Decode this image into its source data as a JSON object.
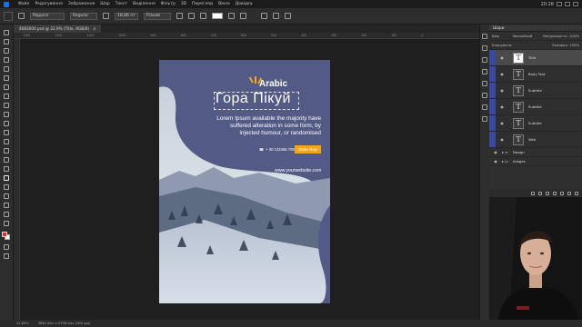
{
  "menu": [
    "Файл",
    "Редагування",
    "Зображення",
    "Шар",
    "Текст",
    "Виділення",
    "Фільтр",
    "3D",
    "Перегляд",
    "Вікно",
    "Довідка"
  ],
  "options": {
    "font_family": "Poppins",
    "font_style": "Regular",
    "font_size": "18,86 пт",
    "aa": "Різкий"
  },
  "document": {
    "tab_label": "4683000.psd @ 22,9% (Title, RGB/8)",
    "close": "×"
  },
  "ruler_ticks": [
    "1300",
    "1200",
    "1100",
    "1000",
    "900",
    "800",
    "700",
    "600",
    "500",
    "400",
    "300",
    "200",
    "100",
    "0",
    "100",
    "200",
    "300",
    "400"
  ],
  "poster": {
    "brand": "Arabic",
    "headline": "Гора Пікуй",
    "body": "Lorem Ipsum available the majority have suffered alteration in some form, by injected humour, or randomised",
    "phone": "+ 00 123456 789",
    "cta": "Order Now",
    "website": "www.yourwebsite.com",
    "colors": {
      "bg": "#535a86",
      "accent": "#f2a71b",
      "brand_icon": "#f2a71b"
    }
  },
  "layers_panel": {
    "tab": "Шари",
    "filter_label": "Вид",
    "mode": "Звичайний",
    "opacity_label": "Непрозорість: 100%",
    "lock_label": "Блокувати:",
    "fill_label": "Заливка: 100%",
    "items": [
      {
        "name": "Title",
        "type": "text",
        "selected": true
      },
      {
        "name": "Body Text",
        "type": "text",
        "selected": false
      },
      {
        "name": "Subtitle",
        "type": "text",
        "selected": false
      },
      {
        "name": "Subtitle",
        "type": "text",
        "selected": false
      },
      {
        "name": "Subtitle",
        "type": "text",
        "selected": false
      },
      {
        "name": "Web",
        "type": "text",
        "selected": false
      }
    ],
    "groups": [
      "Design",
      "Images"
    ]
  },
  "status": {
    "zoom": "22,89%",
    "size": "3840 пікс x 5708 пікс (300 ppi)"
  },
  "clock": "20:28"
}
